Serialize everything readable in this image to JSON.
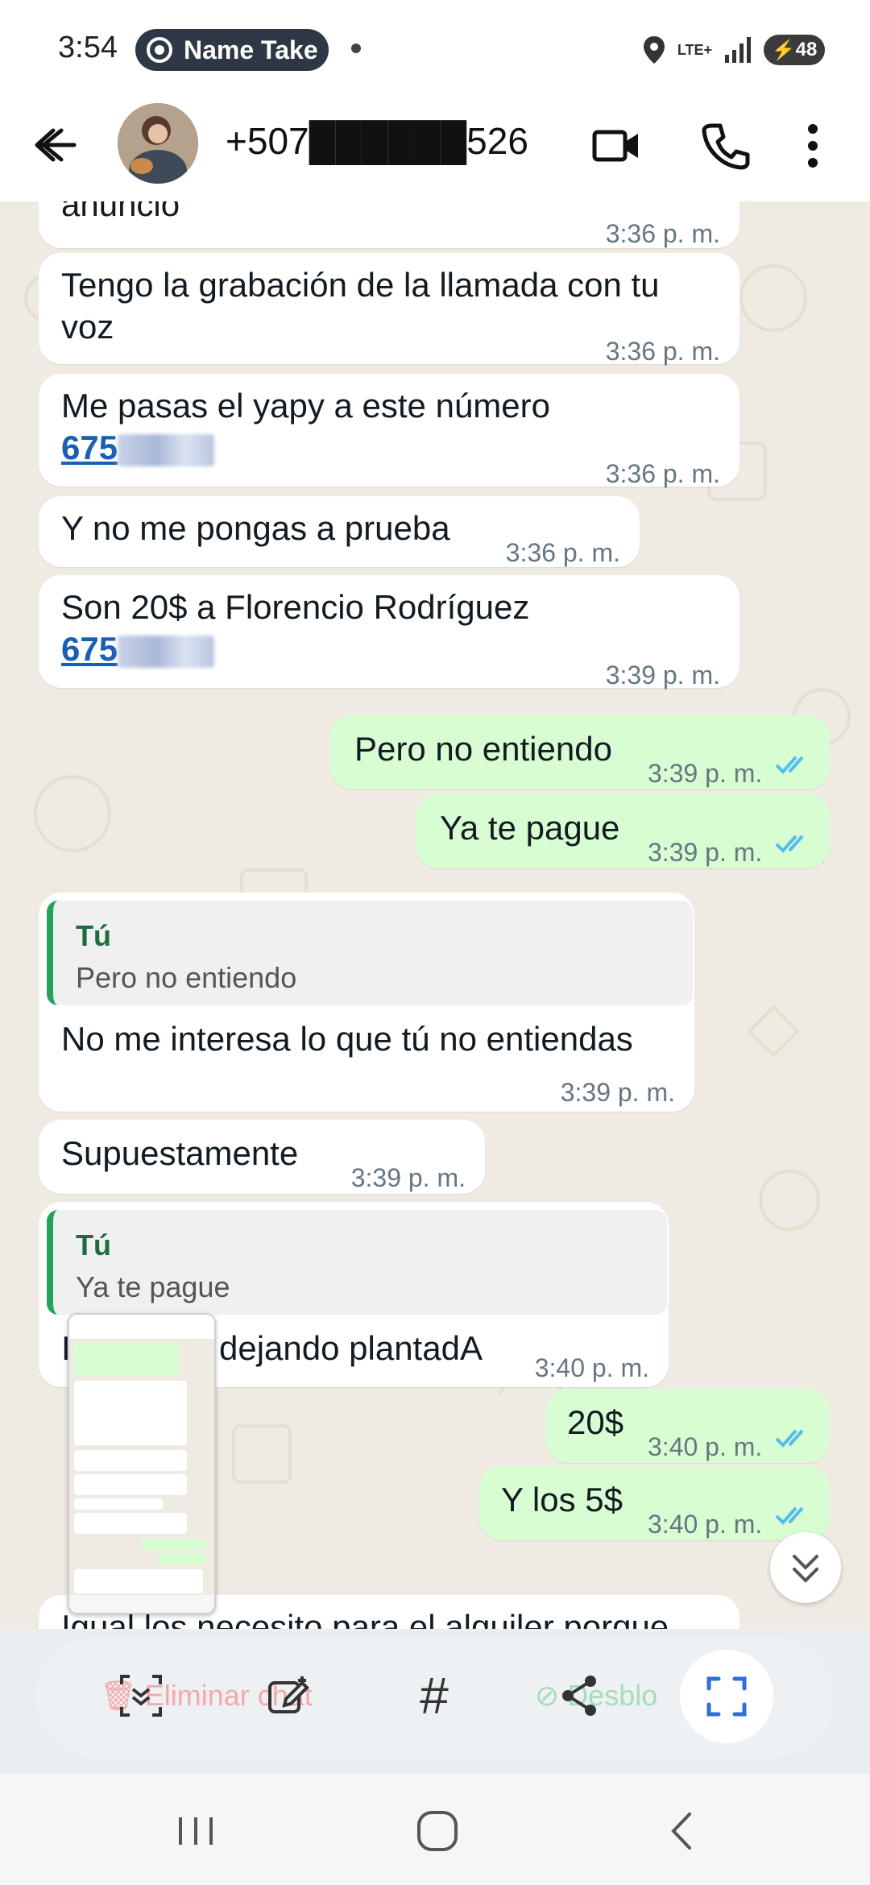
{
  "status_bar": {
    "time": "3:54",
    "recorder_label": "Name Take",
    "network": "LTE+",
    "battery": "48"
  },
  "header": {
    "contact": "+507██████526"
  },
  "messages": [
    {
      "text": "anuncio",
      "time": "3:36 p. m."
    },
    {
      "text": "Tengo la grabación de la llamada con tu voz",
      "line1": "Tengo la grabación de la llamada con tu",
      "line2": "voz",
      "time": "3:36 p. m."
    },
    {
      "text": "Me pasas el yapy a este número",
      "phone": "675",
      "time": "3:36 p. m."
    },
    {
      "text": "Y no me pongas a prueba",
      "time": "3:36 p. m."
    },
    {
      "text": "Son 20$ a Florencio Rodríguez",
      "phone": "675",
      "time": "3:39 p. m."
    },
    {
      "text": "Pero no entiendo",
      "time": "3:39 p. m.",
      "outgoing": true
    },
    {
      "text": "Ya te pague",
      "time": "3:39 p. m.",
      "outgoing": true
    },
    {
      "quote_name": "Tú",
      "quote_text": "Pero no entiendo",
      "text": "No me interesa lo que tú no entiendas",
      "time": "3:39 p. m."
    },
    {
      "text": "Supuestamente",
      "time": "3:39 p. m."
    },
    {
      "quote_name": "Tú",
      "quote_text": "Ya te pague",
      "text": "dejando plantadA",
      "text_prefix": "I",
      "time": "3:40 p. m."
    },
    {
      "text": "20$",
      "time": "3:40 p. m.",
      "outgoing": true
    },
    {
      "text": "Y los 5$",
      "time": "3:40 p. m.",
      "outgoing": true
    },
    {
      "text": "Igual los necesito para el alquiler porque"
    }
  ],
  "toolbar": {
    "ghost_delete": "Eliminar chat",
    "ghost_unblock": "Desblo"
  },
  "icons": {
    "back": "arrow-left-icon",
    "video": "video-call-icon",
    "call": "phone-icon",
    "menu": "more-vert-icon",
    "read": "double-check-icon",
    "scroll": "chevron-double-down-icon"
  },
  "colors": {
    "incoming": "#ffffff",
    "outgoing": "#d9fdd3",
    "link": "#1a5fb4",
    "read_ticks": "#53bdeb",
    "quote_bar": "#25a35a"
  }
}
